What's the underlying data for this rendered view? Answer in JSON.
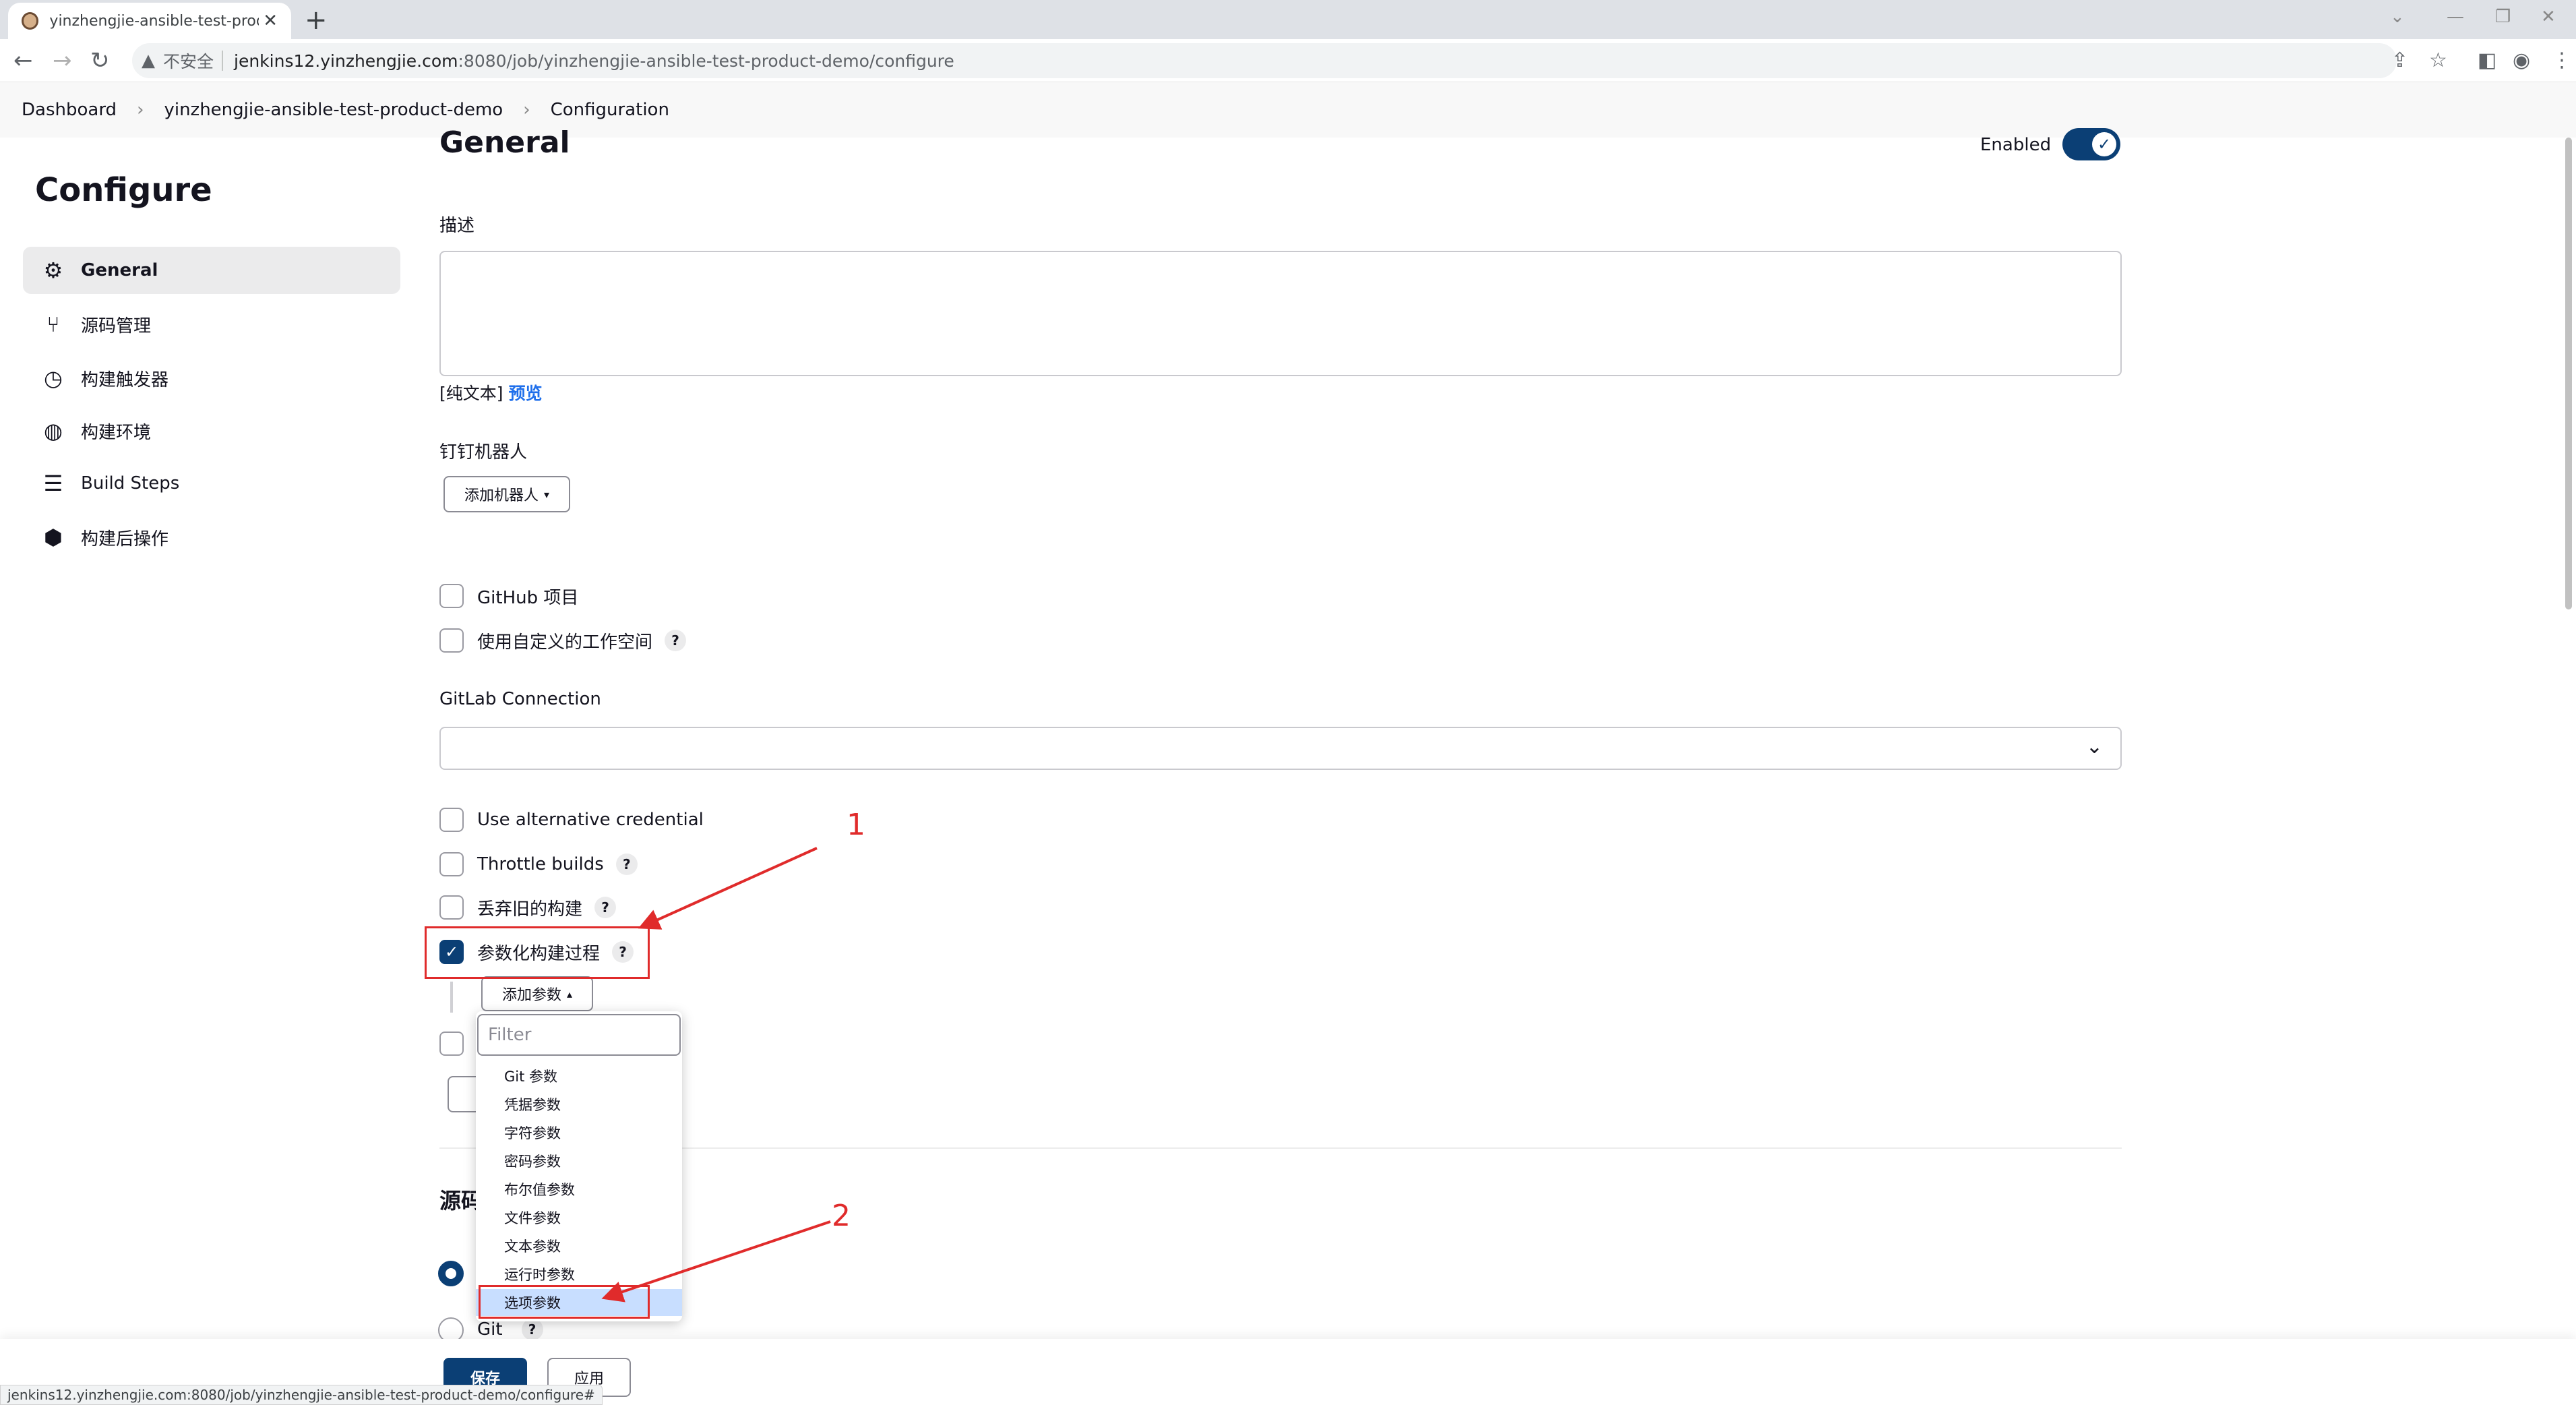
{
  "browser": {
    "tab_title": "yinzhengjie-ansible-test-product-demo",
    "tab_close": "✕",
    "new_tab": "+",
    "insecure_label": "不安全",
    "url_host": "jenkins12.yinzhengjie.com",
    "url_path": ":8080/job/yinzhengjie-ansible-test-product-demo/configure",
    "status_url": "jenkins12.yinzhengjie.com:8080/job/yinzhengjie-ansible-test-product-demo/configure#"
  },
  "breadcrumbs": [
    "Dashboard",
    "yinzhengjie-ansible-test-product-demo",
    "Configuration"
  ],
  "sidebar": {
    "title": "Configure",
    "items": [
      {
        "label": "General",
        "icon": "gear-icon"
      },
      {
        "label": "源码管理",
        "icon": "branch-icon"
      },
      {
        "label": "构建触发器",
        "icon": "clock-icon"
      },
      {
        "label": "构建环境",
        "icon": "globe-icon"
      },
      {
        "label": "Build Steps",
        "icon": "list-icon"
      },
      {
        "label": "构建后操作",
        "icon": "cube-icon"
      }
    ]
  },
  "general": {
    "title": "General",
    "enabled_label": "Enabled",
    "enabled": true,
    "description_label": "描述",
    "plain_text": "[纯文本]",
    "preview": "预览",
    "dingtalk_label": "钉钉机器人",
    "add_robot": "添加机器人",
    "github_project": "GitHub 项目",
    "custom_workspace": "使用自定义的工作空间",
    "gitlab_connection_label": "GitLab Connection",
    "use_alt_credential": "Use alternative credential",
    "throttle_builds": "Throttle builds",
    "discard_old_builds": "丢弃旧的构建",
    "parameterized": "参数化构建过程",
    "parameterized_checked": true,
    "add_param": "添加参数",
    "help": "?"
  },
  "dropdown": {
    "filter_placeholder": "Filter",
    "items": [
      "Git 参数",
      "凭据参数",
      "字符参数",
      "密码参数",
      "布尔值参数",
      "文件参数",
      "文本参数",
      "运行时参数",
      "选项参数"
    ],
    "selected": "选项参数"
  },
  "scm": {
    "title_partial": "源码",
    "git_label": "Git"
  },
  "annotations": {
    "first": "1",
    "second": "2",
    "color": "#e02b2b"
  },
  "footer": {
    "save": "保存",
    "apply": "应用"
  },
  "colors": {
    "accent": "#0b3f75",
    "link": "#1f6feb",
    "selection": "#c8deff"
  }
}
